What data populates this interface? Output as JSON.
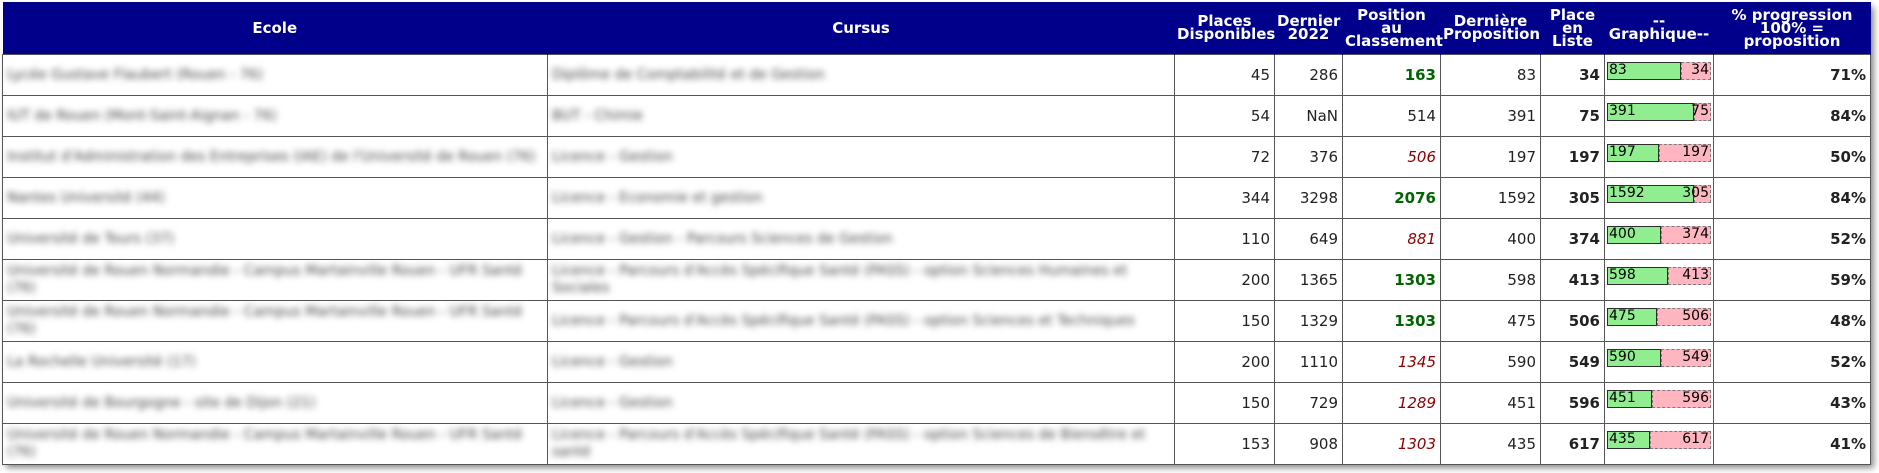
{
  "headers": {
    "ecole": "Ecole",
    "cursus": "Cursus",
    "places": "Places Disponibles",
    "dernier": "Dernier 2022",
    "position": "Position au Classement",
    "derniere_prop": "Dernière Proposition",
    "place_liste": "Place en Liste",
    "graphique": "--Graphique--",
    "progression": "% progression 100% = proposition"
  },
  "colors": {
    "header_bg": "#00008b",
    "position_green": "#006400",
    "position_red": "#8b0000",
    "position_nan": "#bbbbbb",
    "bar_done": "#90ee90",
    "bar_remaining": "#ffb6c1"
  },
  "rows": [
    {
      "ecole": "Lycée Gustave Flaubert (Rouen - 76)",
      "cursus": "Diplôme de Comptabilité et de Gestion",
      "places": "45",
      "dernier": "286",
      "position": "163",
      "position_status": "green",
      "derniere": "83",
      "place": "34",
      "bar_left": "83",
      "bar_right": "34",
      "progress": 0.71,
      "pct": "71%"
    },
    {
      "ecole": "IUT de Rouen (Mont-Saint-Aignan - 76)",
      "cursus": "BUT - Chimie",
      "places": "54",
      "dernier": "NaN",
      "position": "514",
      "position_status": "nan",
      "derniere": "391",
      "place": "75",
      "bar_left": "391",
      "bar_right": "75",
      "progress": 0.84,
      "pct": "84%"
    },
    {
      "ecole": "Institut d'Administration des Entreprises (IAE) de l'Université de Rouen (76)",
      "cursus": "Licence - Gestion",
      "places": "72",
      "dernier": "376",
      "position": "506",
      "position_status": "red",
      "derniere": "197",
      "place": "197",
      "bar_left": "197",
      "bar_right": "197",
      "progress": 0.5,
      "pct": "50%"
    },
    {
      "ecole": "Nantes Université (44)",
      "cursus": "Licence - Economie et gestion",
      "places": "344",
      "dernier": "3298",
      "position": "2076",
      "position_status": "green",
      "derniere": "1592",
      "place": "305",
      "bar_left": "1592",
      "bar_right": "305",
      "progress": 0.84,
      "pct": "84%"
    },
    {
      "ecole": "Université de Tours (37)",
      "cursus": "Licence - Gestion - Parcours Sciences de Gestion",
      "places": "110",
      "dernier": "649",
      "position": "881",
      "position_status": "red",
      "derniere": "400",
      "place": "374",
      "bar_left": "400",
      "bar_right": "374",
      "progress": 0.52,
      "pct": "52%"
    },
    {
      "ecole": "Université de Rouen Normandie - Campus Martainville Rouen - UFR Santé (76)",
      "cursus": "Licence - Parcours d'Accès Spécifique Santé (PASS) - option Sciences Humaines et Sociales",
      "places": "200",
      "dernier": "1365",
      "position": "1303",
      "position_status": "green",
      "derniere": "598",
      "place": "413",
      "bar_left": "598",
      "bar_right": "413",
      "progress": 0.59,
      "pct": "59%"
    },
    {
      "ecole": "Université de Rouen Normandie - Campus Martainville Rouen - UFR Santé (76)",
      "cursus": "Licence - Parcours d'Accès Spécifique Santé (PASS) - option Sciences et Techniques",
      "places": "150",
      "dernier": "1329",
      "position": "1303",
      "position_status": "green",
      "derniere": "475",
      "place": "506",
      "bar_left": "475",
      "bar_right": "506",
      "progress": 0.48,
      "pct": "48%"
    },
    {
      "ecole": "La Rochelle Université (17)",
      "cursus": "Licence - Gestion",
      "places": "200",
      "dernier": "1110",
      "position": "1345",
      "position_status": "red",
      "derniere": "590",
      "place": "549",
      "bar_left": "590",
      "bar_right": "549",
      "progress": 0.52,
      "pct": "52%"
    },
    {
      "ecole": "Université de Bourgogne - site de Dijon (21)",
      "cursus": "Licence - Gestion",
      "places": "150",
      "dernier": "729",
      "position": "1289",
      "position_status": "red",
      "derniere": "451",
      "place": "596",
      "bar_left": "451",
      "bar_right": "596",
      "progress": 0.43,
      "pct": "43%"
    },
    {
      "ecole": "Université de Rouen Normandie - Campus Martainville Rouen - UFR Santé (76)",
      "cursus": "Licence - Parcours d'Accès Spécifique Santé (PASS) - option Sciences de Biensêtre et santé",
      "places": "153",
      "dernier": "908",
      "position": "1303",
      "position_status": "red",
      "derniere": "435",
      "place": "617",
      "bar_left": "435",
      "bar_right": "617",
      "progress": 0.41,
      "pct": "41%"
    }
  ]
}
